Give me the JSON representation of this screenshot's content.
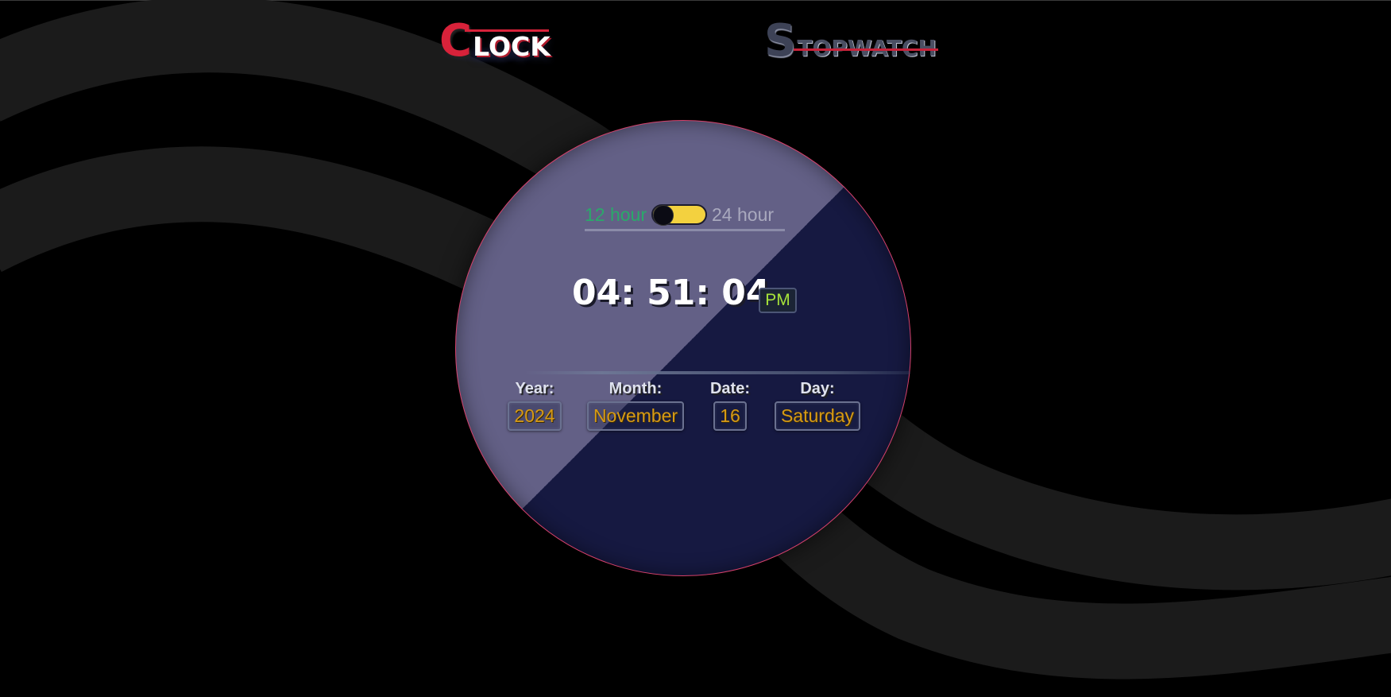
{
  "nav": {
    "clock_first": "C",
    "clock_rest": "LOCK",
    "stopwatch_first": "S",
    "stopwatch_rest": "TOPWATCH",
    "active_tab": "clock"
  },
  "format_toggle": {
    "label_12": "12 hour",
    "label_24": "24 hour",
    "selected": "12 hour"
  },
  "time": {
    "display": "04: 51: 04",
    "period": "PM"
  },
  "date": {
    "year_label": "Year:",
    "year_value": "2024",
    "month_label": "Month:",
    "month_value": "November",
    "date_label": "Date:",
    "date_value": "16",
    "day_label": "Day:",
    "day_value": "Saturday"
  },
  "colors": {
    "background": "#000000",
    "face_light": "#636086",
    "face_dark": "#161941",
    "face_border": "#d5406a",
    "accent_red": "#d8223a",
    "label_12_color": "#2aa96a",
    "toggle_yellow": "#f3d13f",
    "period_green": "#a6e33a",
    "value_orange": "#d69a16"
  }
}
